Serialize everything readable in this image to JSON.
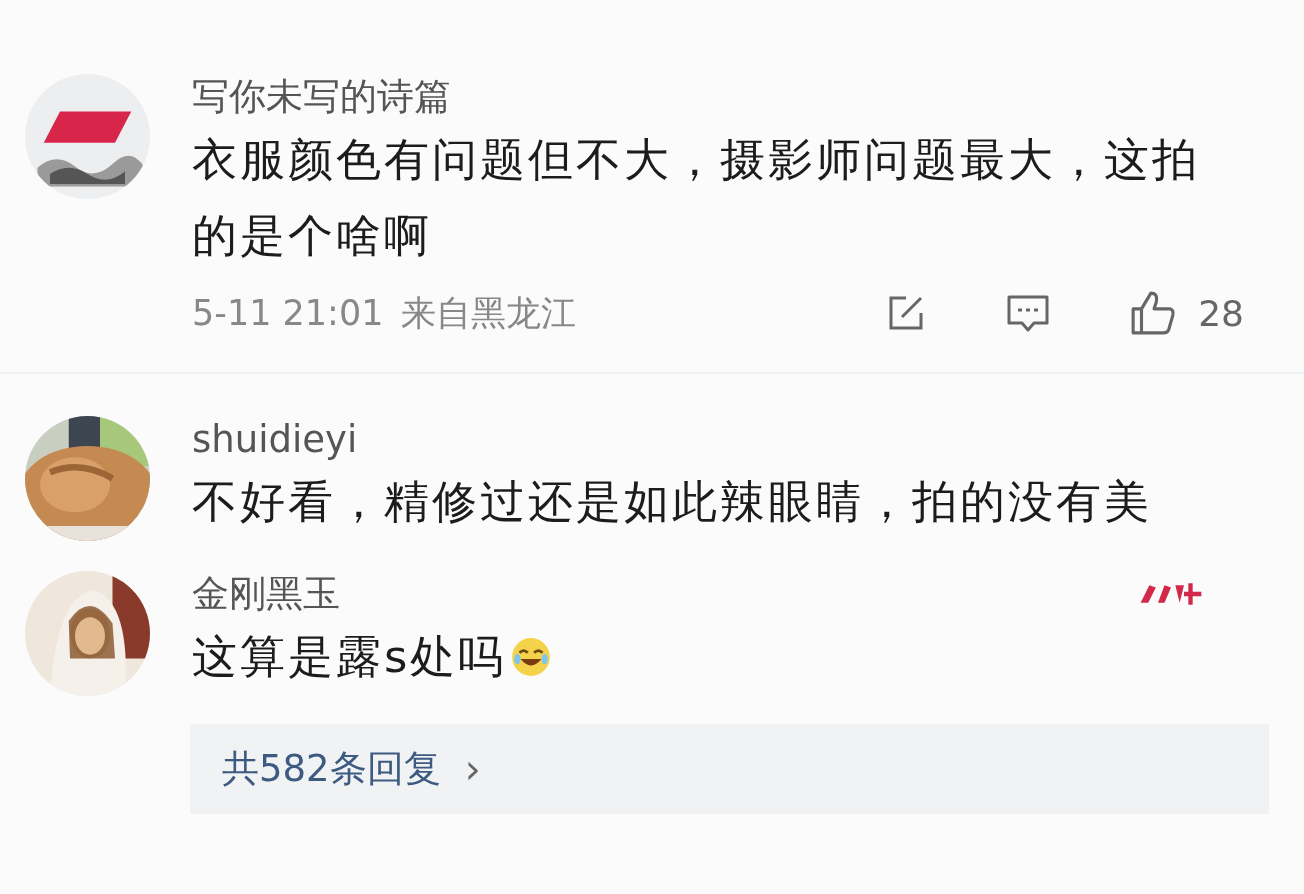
{
  "comments": [
    {
      "username": "写你未写的诗篇",
      "avatar": {
        "kind": "logo"
      },
      "text": "衣服颜色有问题但不大，摄影师问题最大，这拍的是个啥啊",
      "meta": {
        "time": "5-11 21:01",
        "location": "来自黑龙江",
        "likes": "28"
      },
      "badge": false
    },
    {
      "username": "shuidieyi",
      "avatar": {
        "kind": "cat"
      },
      "text": "不好看，精修过还是如此辣眼睛，拍的没有美",
      "badge": false
    },
    {
      "username": "金刚黑玉",
      "avatar": {
        "kind": "person"
      },
      "text": "这算是露s处吗",
      "emoji": {
        "kind": "laughing"
      },
      "badge": true
    }
  ],
  "replies": {
    "label": "共582条回复",
    "chevron": "›"
  }
}
